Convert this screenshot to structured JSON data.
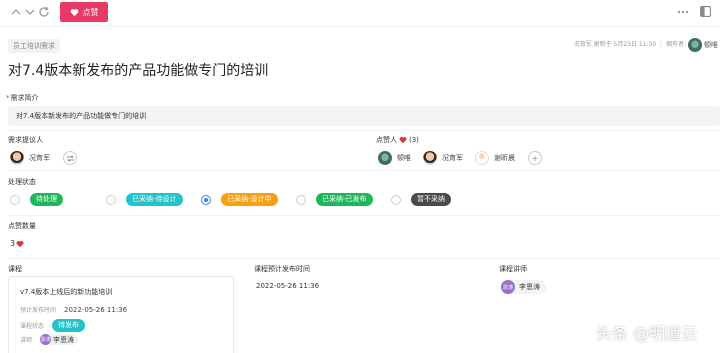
{
  "toolbar": {
    "like_label": "点赞"
  },
  "header": {
    "tag": "员工培训需求",
    "meta": "况育军 更新于 5月23日 11:30 ｜ 拥有者:",
    "owner_name": "顿唯",
    "title": "对7.4版本新发布的产品功能做专门的培训"
  },
  "brief": {
    "label": "需求简介",
    "value": "对7.4版本新发布的产品功能做专门的培训"
  },
  "proposer": {
    "label": "需求提议人",
    "name": "况育军"
  },
  "likers": {
    "label": "点赞人",
    "count": "(3)",
    "people": [
      {
        "name": "顿唯"
      },
      {
        "name": "况育军"
      },
      {
        "name": "谢昕晨"
      }
    ]
  },
  "status": {
    "label": "处理状态",
    "options": [
      {
        "label": "待处理",
        "color": "#1fb75a",
        "checked": false
      },
      {
        "label": "已采纳-待设计",
        "color": "#22c3c9",
        "checked": false
      },
      {
        "label": "已采纳-设计中",
        "color": "#f5a113",
        "checked": true
      },
      {
        "label": "已采纳-已发布",
        "color": "#1fb75a",
        "checked": false
      },
      {
        "label": "暂不采纳",
        "color": "#4a4a4a",
        "checked": false
      }
    ]
  },
  "like_count": {
    "label": "点赞数量",
    "value": "3"
  },
  "course": {
    "label": "课程",
    "card_title": "v7.4版本上线后的新功能培训",
    "publish_time_label": "预计发布时间",
    "publish_time": "2022-05-26 11:36",
    "status_label": "课程状态",
    "status_value": "待发布",
    "status_color": "#22c3c9",
    "lecturer_label": "讲师",
    "lecturer_name": "李恩涛",
    "lecturer_avatar_text": "恩涛"
  },
  "publish": {
    "label": "课程预计发布时间",
    "value": "2022-05-26 11:36"
  },
  "lecturer": {
    "label": "课程讲师",
    "name": "李恩涛",
    "avatar_text": "恩涛"
  },
  "watermark": "头条 @明道云"
}
